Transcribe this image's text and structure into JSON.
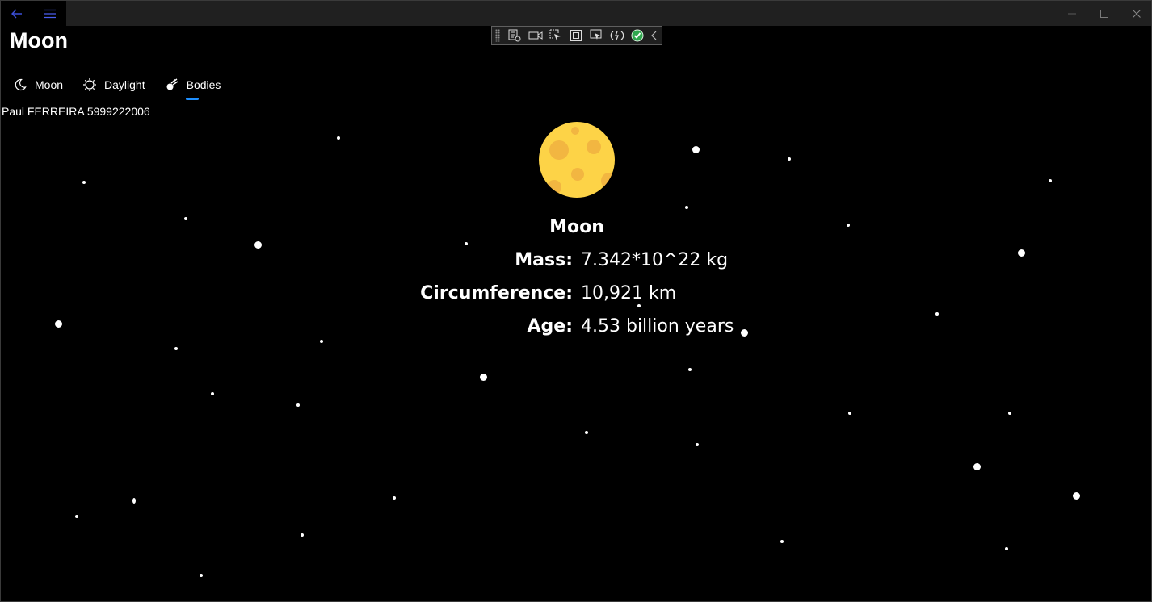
{
  "app": {
    "title": "Moon",
    "author": "Paul FERREIRA 5999222006"
  },
  "icons": {
    "back": "back-arrow-icon",
    "menu": "hamburger-icon",
    "minimize": "minimize-icon",
    "maximize": "maximize-icon",
    "close": "close-icon"
  },
  "tabs": [
    {
      "label": "Moon",
      "icon": "moon-icon",
      "selected": false
    },
    {
      "label": "Daylight",
      "icon": "sun-icon",
      "selected": false
    },
    {
      "label": "Bodies",
      "icon": "comet-icon",
      "selected": true
    }
  ],
  "body": {
    "name": "Moon",
    "rows": [
      {
        "label": "Mass:",
        "value": "7.342*10^22 kg"
      },
      {
        "label": "Circumference:",
        "value": "10,921 km"
      },
      {
        "label": "Age:",
        "value": "4.53 billion years"
      }
    ]
  },
  "colors": {
    "accent": "#1e8fff",
    "moon_fill": "#fdd347",
    "moon_craters": "#f2b641",
    "background": "#000000"
  }
}
